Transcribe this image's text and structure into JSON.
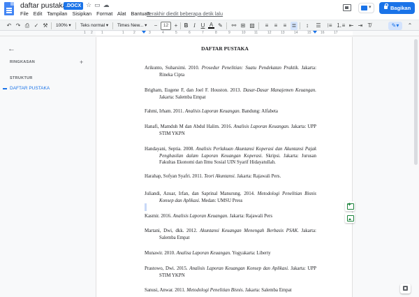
{
  "header": {
    "doc_title": "daftar pustaka",
    "file_badge": ".DOCX",
    "last_edit": "Terakhir diedit beberapa detik lalu",
    "share_label": "Bagikan",
    "menus": [
      "File",
      "Edit",
      "Tampilan",
      "Sisipkan",
      "Format",
      "Alat",
      "Bantuan"
    ]
  },
  "toolbar": {
    "zoom": "100%",
    "style": "Teks normal",
    "font": "Times New...",
    "font_size": "12"
  },
  "ruler": {
    "numbers": [
      "1",
      "2",
      "1",
      "1",
      "2",
      "3",
      "4",
      "5",
      "6",
      "7",
      "8",
      "9",
      "10",
      "11",
      "12",
      "13",
      "14",
      "15",
      "16",
      "17"
    ]
  },
  "sidebar": {
    "summary_heading": "RINGKASAN",
    "structure_heading": "STRUKTUR",
    "outline_items": [
      "DAFTAR PUSTAKA"
    ]
  },
  "document": {
    "title": "DAFTAR PUSTAKA",
    "entries": [
      {
        "author": "Arikunto, Suharsimi. 2010.",
        "title": "Prosedur Penelitian: Suatu Pendekatan Praktik.",
        "pub": "Jakarta: Rineka Cipta"
      },
      {
        "author": "Brigham, Eugene F, dan Joel F. Houston. 2013.",
        "title": "Dasar-Dasar Manajemen Keuangan.",
        "pub": "Jakarta: Salemba Empat"
      },
      {
        "author": "Fahmi, Irham. 2011.",
        "title": "Analisis Laporan Keuangan.",
        "pub": "Bandung: Alfabeta"
      },
      {
        "author": "Hanafi, Mamduh M dan Abdul Halim. 2016.",
        "title": "Analisis Laporan Keuangan.",
        "pub": "Jakarta: UPP STIM YKPN"
      },
      {
        "author": "Handayani, Septia. 2008.",
        "title": "Analisis Perlakuan Akuntansi Koperasi dan Akuntansi Pajak Penghasilan dalam Laporan Keuangan Koperasi.",
        "pub": "Skripsi. Jakarta: Jurusan Fakultas Ekonomi dan Ilmu Sosial UIN Syarif Hidayatullah."
      },
      {
        "author": "Harahap, Sofyan Syafri. 2011.",
        "title": "Teori Akuntansi.",
        "pub": "Jakarta: Rajawali Pers."
      },
      {
        "author": "Juliandi, Azuar, Irfan, dan Saprinal Manurung. 2014.",
        "title": "Metodologi Penelitian Bisnis Konsep dan Aplikasi.",
        "pub": "Medan: UMSU Press"
      },
      {
        "author": "Kasmir. 2016.",
        "title": "Analisis Laporan Keuangan.",
        "pub": "Jakarta: Rajawali Pers"
      },
      {
        "author": "Martani, Dwi, dkk. 2012.",
        "title": "Akuntansi Keuangan Menengah Berbasis PSAK.",
        "pub": "Jakarta: Salemba Empat"
      },
      {
        "author": "Munawir. 2010.",
        "title": "Analisa Laporan Keuangan.",
        "pub": "Yogyakarta: Liberty"
      },
      {
        "author": "Prastowo, Dwi. 2015.",
        "title": "Analisis Laporan Keuangan Konsep dan Aplikasi.",
        "pub": "Jakarta: UPP STIM YKPN"
      },
      {
        "author": "Sanusi, Anwar. 2011.",
        "title": "Metodologi Penelitian Bisnis.",
        "pub": "Jakarta: Salemba Empat"
      }
    ]
  },
  "colors": {
    "accent": "#1a73e8",
    "side_action": "#188038"
  }
}
